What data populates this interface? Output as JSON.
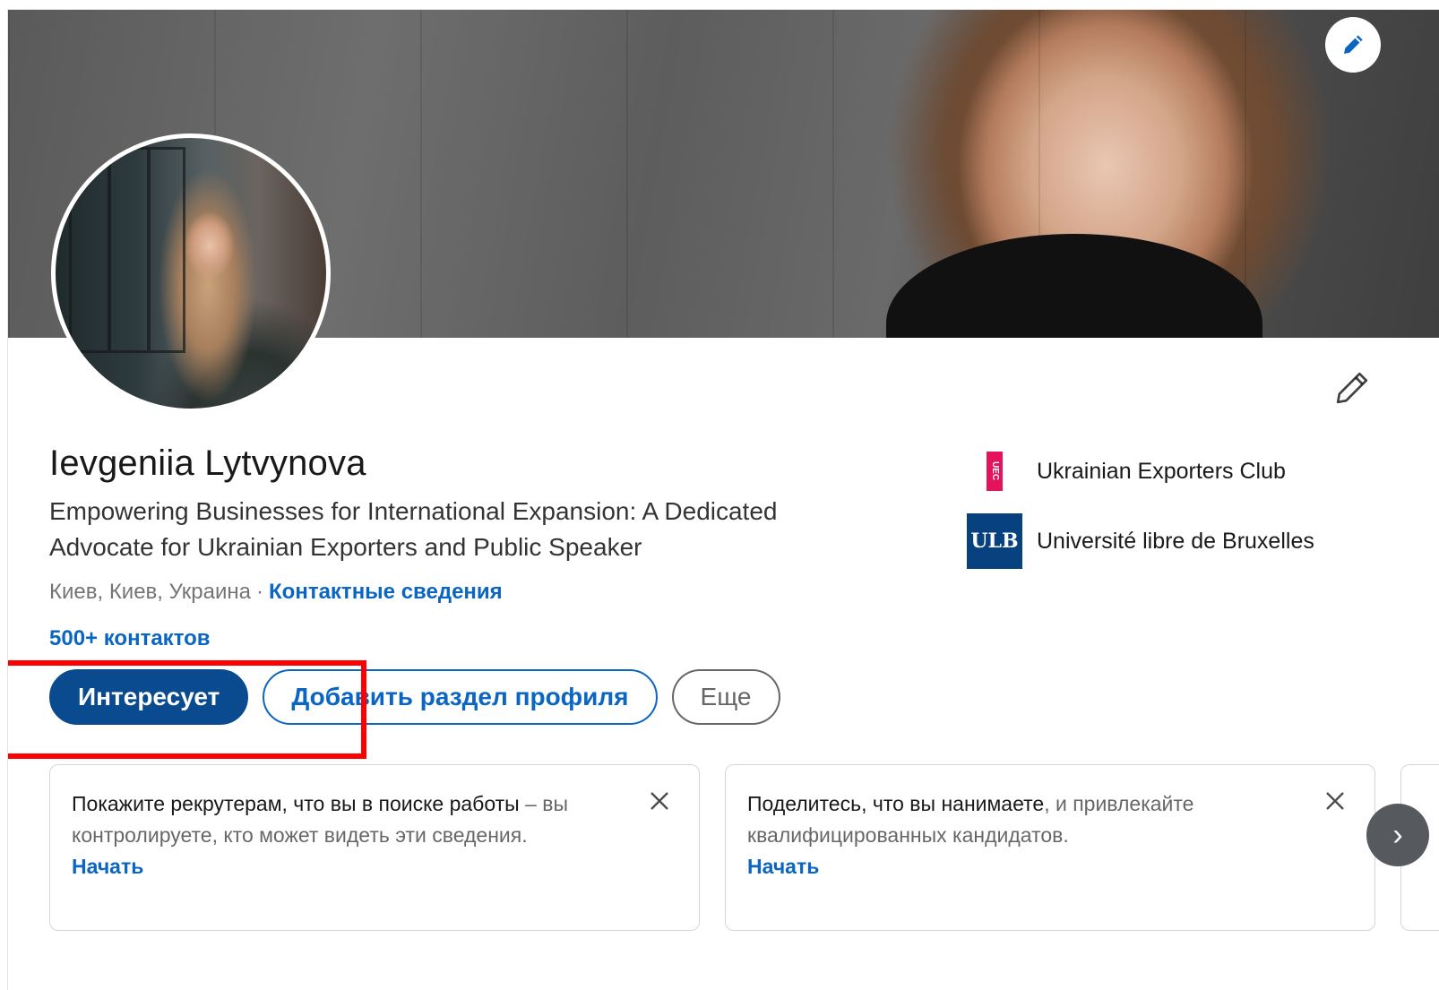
{
  "profile": {
    "name": "Ievgeniia Lytvynova",
    "headline": "Empowering Businesses for International Expansion: A Dedicated Advocate for Ukrainian Exporters and Public Speaker",
    "location": "Киев, Киев, Украина",
    "separator": "·",
    "contact_info_link": "Контактные сведения",
    "connections": "500+ контактов"
  },
  "organizations": [
    {
      "name": "Ukrainian Exporters Club",
      "logo_text": "UEC"
    },
    {
      "name": "Université libre de Bruxelles",
      "logo_text": "ULB"
    }
  ],
  "actions": {
    "open_to": "Интересует",
    "add_section": "Добавить раздел профиля",
    "more": "Еще"
  },
  "tips": [
    {
      "bold": "Покажите рекрутерам, что вы в поиске работы",
      "rest": " – вы контролируете, кто может видеть эти сведения.",
      "cta": "Начать"
    },
    {
      "bold": "Поделитесь, что вы нанимаете",
      "rest": ", и привлекайте квалифицированных кандидатов.",
      "cta": "Начать"
    }
  ],
  "icons": {
    "cover_edit": "pencil-icon",
    "intro_edit": "pencil-icon",
    "close": "close-icon",
    "next": "chevron-right-icon"
  },
  "colors": {
    "brand_blue": "#0a66c2",
    "primary_button": "#0a4b8f",
    "highlight_red": "#ff0000",
    "uec_pink": "#e3145c",
    "ulb_blue": "#07417f"
  },
  "next_glyph": "›"
}
